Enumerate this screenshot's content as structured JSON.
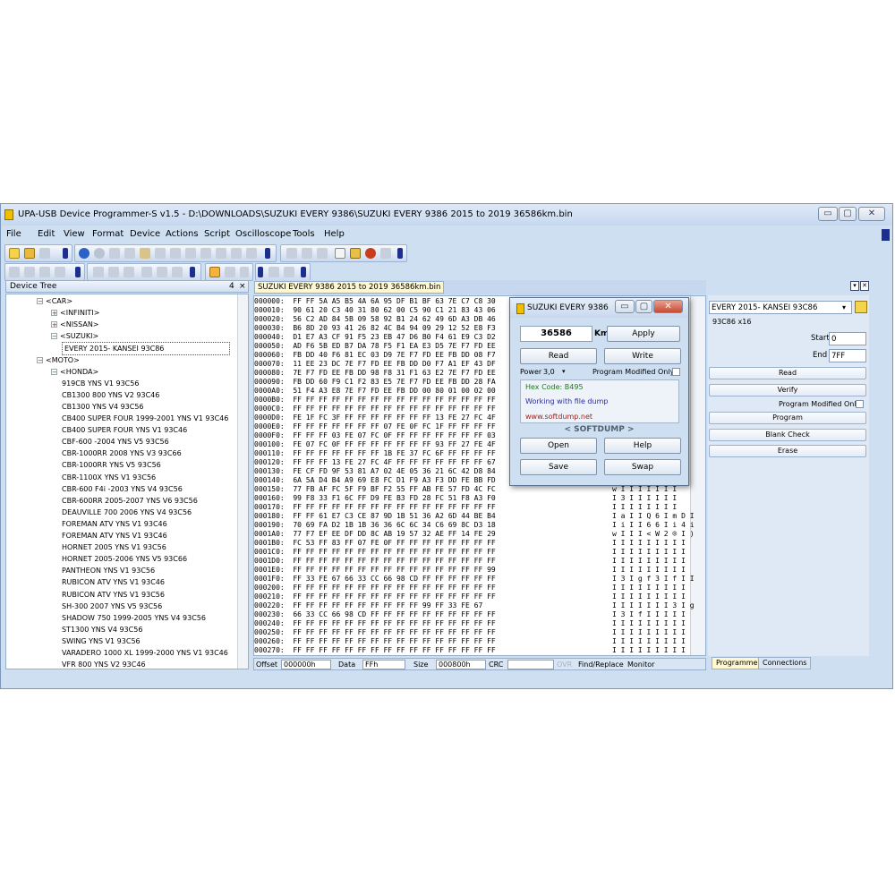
{
  "window": {
    "title": "UPA-USB Device Programmer-S v1.5 - D:\\DOWNLOADS\\SUZUKI EVERY 9386\\SUZUKI EVERY 9386 2015 to 2019 36586km.bin"
  },
  "menu": {
    "items": [
      "File",
      "Edit",
      "View",
      "Format",
      "Device",
      "Actions",
      "Script",
      "Oscilloscope",
      "Tools",
      "Help"
    ]
  },
  "device_tree": {
    "title": "Device Tree",
    "pin": "4",
    "close": "×",
    "nodes": [
      {
        "label": "<CAR>",
        "expander": "−"
      },
      {
        "label": "<INFINITI>",
        "expander": "+"
      },
      {
        "label": "<NISSAN>",
        "expander": "+"
      },
      {
        "label": "<SUZUKI>",
        "expander": "−"
      },
      {
        "label": "EVERY 2015- KANSEI 93C86",
        "expander": ""
      },
      {
        "label": "<MOTO>",
        "expander": "−"
      },
      {
        "label": "<HONDA>",
        "expander": "−"
      },
      {
        "label": "919CB YNS V1 93C56",
        "expander": ""
      },
      {
        "label": "CB1300 800 YNS V2 93C46",
        "expander": ""
      },
      {
        "label": "CB1300 YNS V4 93C56",
        "expander": ""
      },
      {
        "label": "CB400 SUPER FOUR 1999-2001 YNS V1 93C46",
        "expander": ""
      },
      {
        "label": "CB400 SUPER FOUR YNS V1 93C46",
        "expander": ""
      },
      {
        "label": "CBF-600 -2004 YNS V5 93C56",
        "expander": ""
      },
      {
        "label": "CBR-1000RR 2008 YNS V3 93C66",
        "expander": ""
      },
      {
        "label": "CBR-1000RR YNS V5 93C56",
        "expander": ""
      },
      {
        "label": "CBR-1100X YNS V1 93C56",
        "expander": ""
      },
      {
        "label": "CBR-600 F4i -2003 YNS V4 93C56",
        "expander": ""
      },
      {
        "label": "CBR-600RR 2005-2007 YNS V6 93C56",
        "expander": ""
      },
      {
        "label": "DEAUVILLE 700 2006 YNS V4 93C56",
        "expander": ""
      },
      {
        "label": "FOREMAN ATV YNS V1 93C46",
        "expander": ""
      },
      {
        "label": "FOREMAN ATV YNS V1 93C46",
        "expander": ""
      },
      {
        "label": "HORNET 2005 YNS V1 93C56",
        "expander": ""
      },
      {
        "label": "HORNET 2005-2006 YNS V5 93C66",
        "expander": ""
      },
      {
        "label": "PANTHEON YNS V1 93C56",
        "expander": ""
      },
      {
        "label": "RUBICON ATV YNS V1 93C46",
        "expander": ""
      },
      {
        "label": "RUBICON ATV YNS V1 93C56",
        "expander": ""
      },
      {
        "label": "SH-300 2007 YNS V5 93C56",
        "expander": ""
      },
      {
        "label": "SHADOW 750 1999-2005 YNS V4 93C56",
        "expander": ""
      },
      {
        "label": "ST1300 YNS V4 93C56",
        "expander": ""
      },
      {
        "label": "SWING YNS V1 93C56",
        "expander": ""
      },
      {
        "label": "VARADERO 1000 XL 1999-2000 YNS V1 93C46",
        "expander": ""
      },
      {
        "label": "VFR 800 YNS V2 93C46",
        "expander": ""
      }
    ]
  },
  "editor": {
    "tab_label": "SUZUKI EVERY 9386 2015 to 2019 36586km.bin",
    "hex_rows": [
      "000000:  FF FF 5A A5 B5 4A 6A 95 DF B1 BF 63 7E C7 C8 30",
      "000010:  90 61 20 C3 40 31 80 62 00 C5 90 C1 21 83 43 06",
      "000020:  56 C2 AD 84 5B 09 58 92 B1 24 62 49 6D A3 DB 46",
      "000030:  B6 8D 20 93 41 26 82 4C B4 94 09 29 12 52 E8 F3",
      "000040:  D1 E7 A3 CF 91 F5 23 EB 47 D6 B0 F4 61 E9 C3 D2",
      "000050:  AD F6 5B ED B7 DA 78 F5 F1 EA E3 D5 7E F7 FD EE",
      "000060:  FB DD 40 F6 81 EC 03 D9 7E F7 FD EE FB DD 08 F7",
      "000070:  11 EE 23 DC 7E F7 FD EE FB DD D0 F7 A1 EF 43 DF",
      "000080:  7E F7 FD EE FB DD 98 F8 31 F1 63 E2 7E F7 FD EE",
      "000090:  FB DD 60 F9 C1 F2 83 E5 7E F7 FD EE FB DD 28 FA",
      "0000A0:  51 F4 A3 E8 7E F7 FD EE FB DD 00 80 01 00 02 00",
      "0000B0:  FF FF FF FF FF FF FF FF FF FF FF FF FF FF FF FF",
      "0000C0:  FF FF FF FF FF FF FF FF FF FF FF FF FF FF FF FF",
      "0000D0:  FE 1F FC 3F FF FF FF FF FF FF FF 13 FE 27 FC 4F",
      "0000E0:  FF FF FF FF FF FF FF 07 FE 0F FC 1F FF FF FF FF",
      "0000F0:  FF FF FF 03 FE 07 FC 0F FF FF FF FF FF FF FF 03",
      "000100:  FE 07 FC 0F FF FF FF FF FF FF FF 93 FF 27 FE 4F",
      "000110:  FF FF FF FF FF FF FF 1B FE 37 FC 6F FF FF FF FF",
      "000120:  FF FF FF 13 FE 27 FC 4F FF FF FF FF FF FF FF 67",
      "000130:  FE CF FD 9F 53 81 A7 02 4E 05 36 21 6C 42 D8 84",
      "000140:  6A 5A D4 B4 A9 69 E8 FC D1 F9 A3 F3 DD FE BB FD",
      "000150:  77 FB AF FC 5F F9 BF F2 55 FF AB FE 57 FD 4C FC",
      "000160:  99 F8 33 F1 6C FF D9 FE B3 FD 28 FC 51 F8 A3 F0",
      "000170:  FF FF FF FF FF FF FF FF FF FF FF FF FF FF FF FF",
      "000180:  FF FF 61 E7 C3 CE 87 9D 1B 51 36 A2 6D 44 BE B4",
      "000190:  70 69 FA D2 1B 1B 36 36 6C 6C 34 C6 69 8C D3 18",
      "0001A0:  77 F7 EF EE DF DD 8C AB 19 57 32 AE FF 14 FE 29",
      "0001B0:  FC 53 FF 83 FF 07 FE 0F FF FF FF FF FF FF FF FF",
      "0001C0:  FF FF FF FF FF FF FF FF FF FF FF FF FF FF FF FF",
      "0001D0:  FF FF FF FF FF FF FF FF FF FF FF FF FF FF FF FF",
      "0001E0:  FF FF FF FF FF FF FF FF FF FF FF FF FF FF FF 99",
      "0001F0:  FF 33 FE 67 66 33 CC 66 98 CD FF FF FF FF FF FF",
      "000200:  FF FF FF FF FF FF FF FF FF FF FF FF FF FF FF FF",
      "000210:  FF FF FF FF FF FF FF FF FF FF FF FF FF FF FF FF",
      "000220:  FF FF FF FF FF FF FF FF FF FF 99 FF 33 FE 67",
      "000230:  66 33 CC 66 98 CD FF FF FF FF FF FF FF FF FF FF",
      "000240:  FF FF FF FF FF FF FF FF FF FF FF FF FF FF FF FF",
      "000250:  FF FF FF FF FF FF FF FF FF FF FF FF FF FF FF FF",
      "000260:  FF FF FF FF FF FF FF FF FF FF FF FF FF FF FF FF",
      "000270:  FF FF FF FF FF FF FF FF FF FF FF FF FF FF FF FF"
    ],
    "ascii_rows": [
      "I I Z",
      "a",
      "V I",
      "¶",
      "I I",
      "I I",
      "I I",
      "~ I",
      "~ I I",
      "I I",
      "Q I",
      "I I I I I I I I",
      "I I I I I I I I",
      "I I I I I I I",
      "I I I I I I I I",
      "I I I I I I I I",
      "I I I I I I I I",
      "I I I I I I I I",
      "I I I I I I I g",
      "I I I I I I I I",
      "j Z I I I I I I",
      "w I I I I I I I",
      "I 3 I I I I I I",
      "I I I I I I I I",
      "I a I I Q 6 I m D I",
      "I i I I 6 6 I i 4 i",
      "w I I I < W 2 ® I )",
      "I I I I I I I I I",
      "I I I I I I I I I",
      "I I I I I I I I I",
      "I I I I I I I I I",
      "I 3 I g f 3 I f I I",
      "I I I I I I I I I",
      "I I I I I I I I I",
      "I I I I I I I 3 I g",
      "I 3 I f I I I I I",
      "I I I I I I I I I",
      "I I I I I I I I I",
      "I I I I I I I I I",
      "I I I I I I I I I"
    ]
  },
  "status": {
    "offset_label": "Offset",
    "offset_value": "000000h",
    "data_label": "Data",
    "data_value": "FFh",
    "size_label": "Size",
    "size_value": "000800h",
    "crc_label": "CRC",
    "crc_value": "",
    "ovr": "OVR",
    "find_replace": "Find/Replace",
    "monitor": "Monitor"
  },
  "right_panel": {
    "device_select": "EVERY 2015- KANSEI 93C86",
    "chip_info": "93C86 x16",
    "start_label": "Start",
    "start_value": "0",
    "end_label": "End",
    "end_value": "7FF",
    "read": "Read",
    "verify": "Verify",
    "program_modified_only": "Program Modified Only",
    "program": "Program",
    "blank_check": "Blank Check",
    "erase": "Erase",
    "tabs": [
      "Programmer",
      "Connections"
    ]
  },
  "dialog": {
    "title": "SUZUKI EVERY 9386",
    "km_value": "36586",
    "km_unit": "Km",
    "apply": "Apply",
    "read": "Read",
    "write": "Write",
    "power_label": "Power",
    "power_value": "3,0",
    "program_modified_only": "Program Modified Only",
    "hex_code": "Hex Code: B495",
    "working_text": "Working with file dump",
    "website": "www.softdump.net",
    "brand": "< SOFTDUMP >",
    "open": "Open",
    "help": "Help",
    "save": "Save",
    "swap": "Swap"
  },
  "colors": {
    "hex_code": "#1a7a1a",
    "working": "#2a2aa8",
    "website": "#a02020",
    "window_bg": "#cfdff2"
  }
}
